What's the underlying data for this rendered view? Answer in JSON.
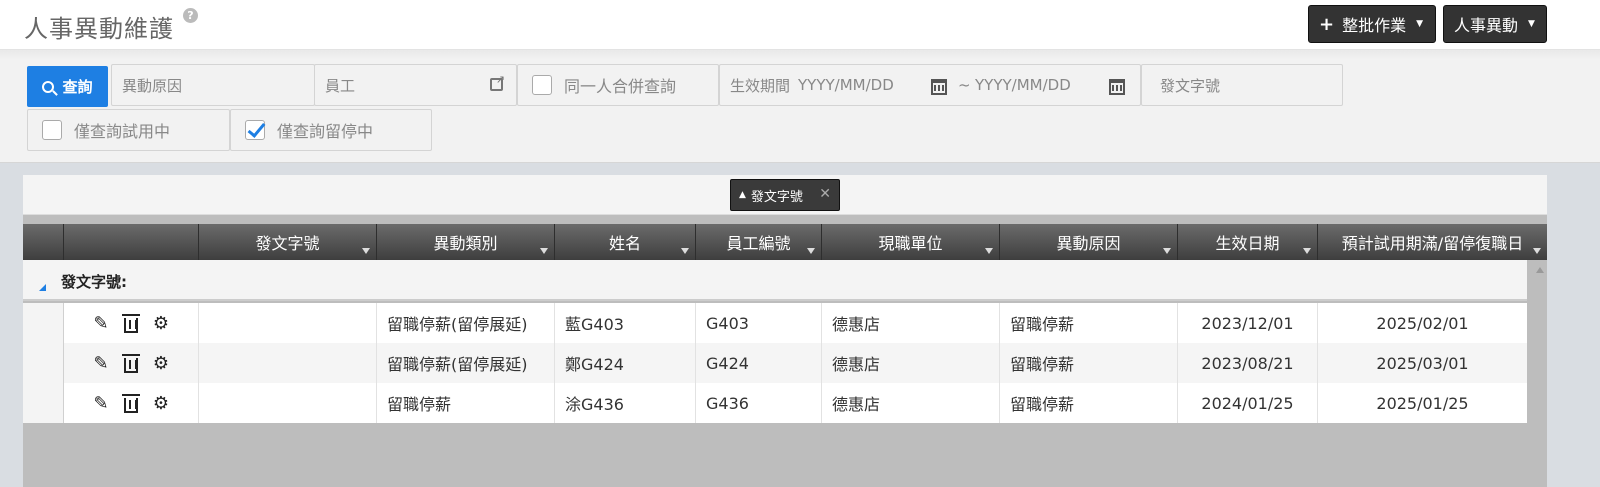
{
  "header": {
    "title": "人事異動維護",
    "help_icon": "?",
    "batch_button": "整批作業",
    "batch_icon": "+",
    "hr_button": "人事異動"
  },
  "filters": {
    "query_button": "查詢",
    "reason_placeholder": "異動原因",
    "employee_placeholder": "員工",
    "merge_label": "同一人合併查詢",
    "merge_checked": false,
    "period_label": "生效期間",
    "date_from_placeholder": "YYYY/MM/DD",
    "date_sep": "~",
    "date_to_placeholder": "YYYY/MM/DD",
    "doc_no_placeholder": "發文字號",
    "trial_label": "僅查詢試用中",
    "trial_checked": false,
    "leave_label": "僅查詢留停中",
    "leave_checked": true
  },
  "grid": {
    "group_chip": "發文字號",
    "columns": [
      "發文字號",
      "異動類別",
      "姓名",
      "員工編號",
      "現職單位",
      "異動原因",
      "生效日期",
      "預計試用期滿/留停復職日"
    ],
    "group_label": "發文字號:",
    "rows": [
      {
        "doc_no": "",
        "type": "留職停薪(留停展延)",
        "name": "藍G403",
        "emp_no": "G403",
        "unit": "德惠店",
        "reason": "留職停薪",
        "effective": "2023/12/01",
        "expected": "2025/02/01"
      },
      {
        "doc_no": "",
        "type": "留職停薪(留停展延)",
        "name": "鄭G424",
        "emp_no": "G424",
        "unit": "德惠店",
        "reason": "留職停薪",
        "effective": "2023/08/21",
        "expected": "2025/03/01"
      },
      {
        "doc_no": "",
        "type": "留職停薪",
        "name": "涂G436",
        "emp_no": "G436",
        "unit": "德惠店",
        "reason": "留職停薪",
        "effective": "2024/01/25",
        "expected": "2025/01/25"
      }
    ]
  },
  "colors": {
    "accent": "#1e7fe3",
    "header_dark": "#333333"
  }
}
